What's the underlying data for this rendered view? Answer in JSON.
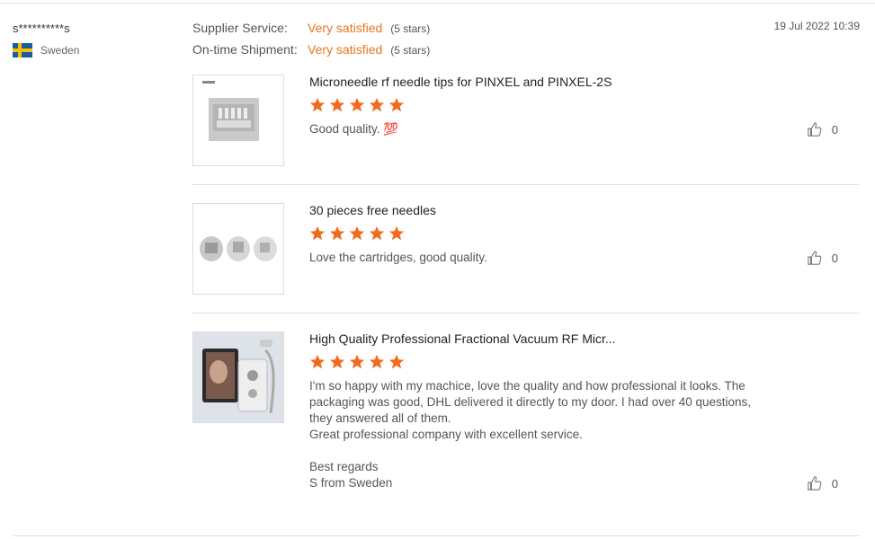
{
  "reviewer": {
    "name": "s**********s",
    "country": "Sweden"
  },
  "ratings": [
    {
      "label": "Supplier Service:",
      "value": "Very satisfied",
      "stars_text": "(5 stars)"
    },
    {
      "label": "On-time Shipment:",
      "value": "Very satisfied",
      "stars_text": "(5 stars)"
    }
  ],
  "date": "19 Jul 2022 10:39",
  "items": [
    {
      "title": "Microneedle rf needle tips for PINXEL and PINXEL-2S",
      "stars": 5,
      "text": "Good quality. 💯",
      "likes": "0",
      "thumb_icon": "needle-tip-box-image"
    },
    {
      "title": "30 pieces free needles",
      "stars": 5,
      "text": "Love the cartridges, good quality.",
      "likes": "0",
      "thumb_icon": "needle-cartridges-image"
    },
    {
      "title": "High Quality Professional Fractional Vacuum RF Micr...",
      "stars": 5,
      "text_lines": [
        "I'm so happy with my machice, love the quality and how professional it looks. The",
        "packaging was good, DHL delivered it directly to my door. I had over 40 questions,",
        "they answered all of them.",
        "Great professional company with excellent service.",
        "",
        "Best regards",
        "S from Sweden"
      ],
      "likes": "0",
      "thumb_icon": "rf-machine-image"
    }
  ],
  "colors": {
    "accent": "#e8761f",
    "star": "#f26b1d"
  }
}
